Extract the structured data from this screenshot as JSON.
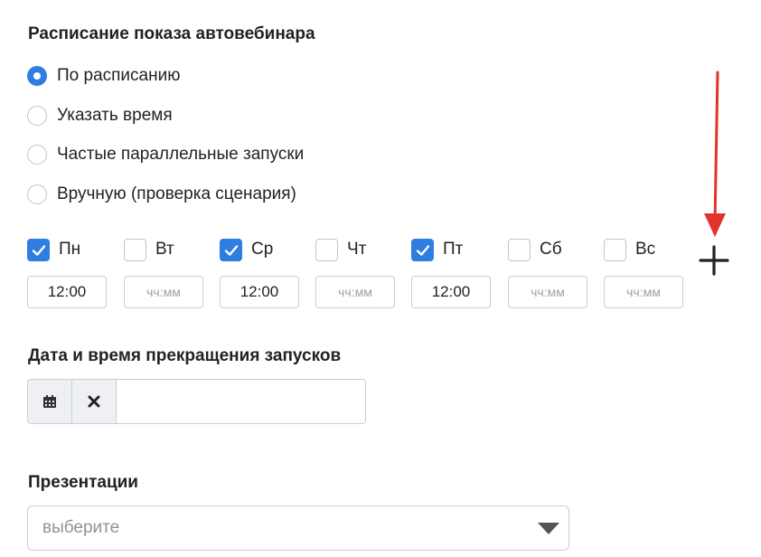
{
  "schedule": {
    "title": "Расписание показа автовебинара",
    "options": [
      {
        "label": "По расписанию",
        "checked": true
      },
      {
        "label": "Указать время",
        "checked": false
      },
      {
        "label": "Частые параллельные запуски",
        "checked": false
      },
      {
        "label": "Вручную (проверка сценария)",
        "checked": false
      }
    ],
    "days": [
      {
        "label": "Пн",
        "checked": true,
        "time": "12:00",
        "placeholder": "чч:мм"
      },
      {
        "label": "Вт",
        "checked": false,
        "time": "",
        "placeholder": "чч:мм"
      },
      {
        "label": "Ср",
        "checked": true,
        "time": "12:00",
        "placeholder": "чч:мм"
      },
      {
        "label": "Чт",
        "checked": false,
        "time": "",
        "placeholder": "чч:мм"
      },
      {
        "label": "Пт",
        "checked": true,
        "time": "12:00",
        "placeholder": "чч:мм"
      },
      {
        "label": "Сб",
        "checked": false,
        "time": "",
        "placeholder": "чч:мм"
      },
      {
        "label": "Вс",
        "checked": false,
        "time": "",
        "placeholder": "чч:мм"
      }
    ],
    "add_icon": "plus-icon",
    "annotation_arrow_color": "#e2332b"
  },
  "stop_date": {
    "title": "Дата и время прекращения запусков",
    "calendar_icon": "calendar-icon",
    "clear_icon": "close-icon",
    "value": ""
  },
  "presentations": {
    "title": "Презентации",
    "placeholder": "выберите",
    "caret_icon": "caret-down-icon"
  },
  "colors": {
    "accent": "#2f7de1",
    "border": "#c9ced6",
    "addon_bg": "#eef0f3"
  }
}
